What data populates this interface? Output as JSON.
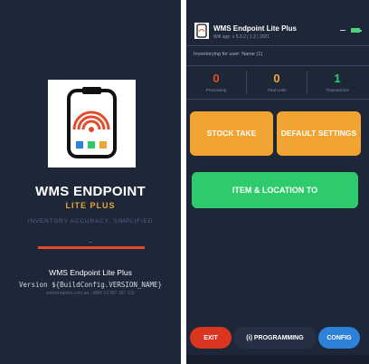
{
  "splash": {
    "title": "WMS ENDPOINT",
    "subtitle": "LITE PLUS",
    "tagline": "INVENTORY ACCURACY, SIMPLIFIED",
    "loading_text": "_",
    "app_name": "WMS Endpoint Lite Plus",
    "version": "Version ${BuildConfig.VERSION_NAME}",
    "contact": "wmsendpoint.com.au  ·  ABN 13 087 337 101"
  },
  "main": {
    "app_bar": {
      "title": "WMS Endpoint Lite Plus",
      "subtitle": "Wifi app: v 5.3.2 | 1.2 | 2021"
    },
    "info_text": "Inventorying for user: Name (1)",
    "stats": [
      {
        "value": "0",
        "label": "Processing",
        "color": "#e24b2c"
      },
      {
        "value": "0",
        "label": "Total Units",
        "color": "#f2a433"
      },
      {
        "value": "1",
        "label": "Transactions",
        "color": "#2ecb6c"
      }
    ],
    "buttons": {
      "stock_take": "STOCK TAKE",
      "default_settings": "DEFAULT SETTINGS",
      "item_location": "ITEM & LOCATION TO",
      "exit": "EXIT",
      "programming": "(i) PROGRAMMING",
      "config": "CONFIG"
    }
  },
  "colors": {
    "background": "#1e2738",
    "orange": "#f2a433",
    "green": "#2ecb6c",
    "red": "#d9351f",
    "blue": "#2e81d8"
  }
}
